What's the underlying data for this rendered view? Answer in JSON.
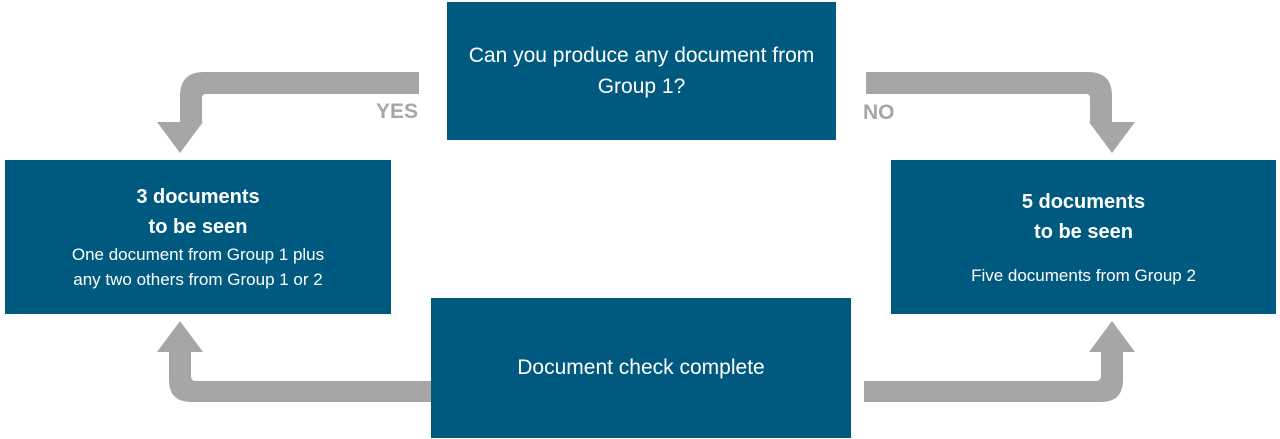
{
  "colors": {
    "box_fill": "#005a80",
    "box_text": "#ffffff",
    "arrow": "#a6a6a6",
    "label": "#a6a6a6"
  },
  "question": {
    "text": "Can you produce any document from Group 1?"
  },
  "branches": {
    "yes_label": "YES",
    "no_label": "NO"
  },
  "yes_outcome": {
    "heading_line1": "3 documents",
    "heading_line2": "to be seen",
    "body_line1": "One document from Group 1 plus",
    "body_line2": "any two others from Group 1 or 2"
  },
  "no_outcome": {
    "heading_line1": "5 documents",
    "heading_line2": "to be seen",
    "body_line1": "Five documents from Group 2"
  },
  "result": {
    "text": "Document check complete"
  }
}
